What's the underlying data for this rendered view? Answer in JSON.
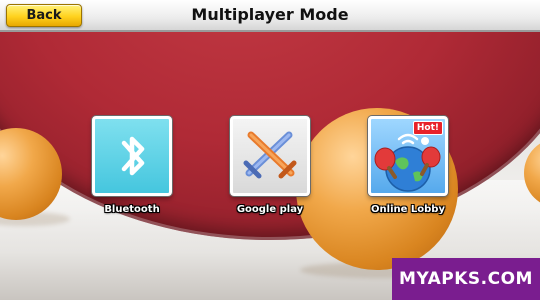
{
  "header": {
    "back_label": "Back",
    "title": "Multiplayer Mode"
  },
  "modes": [
    {
      "label": "Bluetooth",
      "icon": "bluetooth-icon"
    },
    {
      "label": "Google play",
      "icon": "crossed-swords-icon"
    },
    {
      "label": "Online Lobby",
      "icon": "globe-paddles-icon",
      "badge": "Hot!"
    }
  ],
  "watermark": "MYAPKS.COM",
  "colors": {
    "back_button": "#ffd21e",
    "bluetooth_tile": "#45c6de",
    "online_tile": "#56a9ec",
    "hot_badge": "#e8222a",
    "watermark_bg": "#7a1d8f",
    "paddle": "#b02a36",
    "ball": "#f1a84a"
  }
}
